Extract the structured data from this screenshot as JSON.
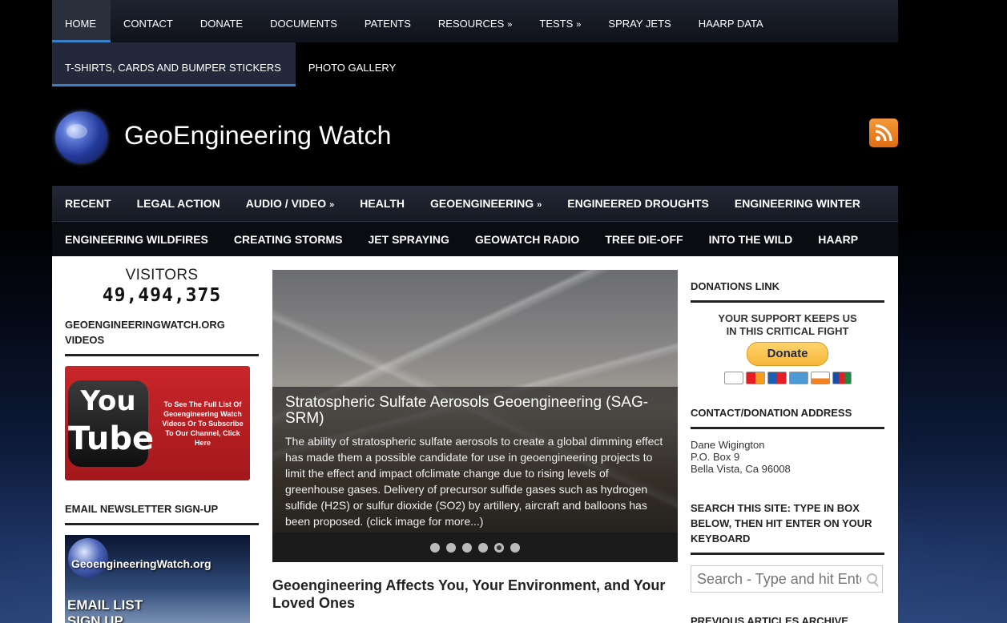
{
  "top_nav": {
    "row1": [
      {
        "label": "HOME",
        "active": true
      },
      {
        "label": "CONTACT"
      },
      {
        "label": "DONATE"
      },
      {
        "label": "DOCUMENTS"
      },
      {
        "label": "PATENTS"
      },
      {
        "label": "RESOURCES",
        "submenu": "»"
      },
      {
        "label": "TESTS",
        "submenu": "»"
      },
      {
        "label": "SPRAY JETS"
      },
      {
        "label": "HAARP DATA"
      }
    ],
    "row2": [
      {
        "label": "T-SHIRTS, CARDS AND BUMPER STICKERS"
      },
      {
        "label": "PHOTO GALLERY"
      }
    ]
  },
  "header": {
    "site_title": "GeoEngineering Watch",
    "logo_icon": "globe-icon",
    "rss_icon": "rss-icon"
  },
  "main_nav": {
    "row1": [
      {
        "label": "RECENT"
      },
      {
        "label": "LEGAL ACTION"
      },
      {
        "label": "AUDIO / VIDEO",
        "submenu": "»"
      },
      {
        "label": "HEALTH"
      },
      {
        "label": "GEOENGINEERING",
        "submenu": "»"
      },
      {
        "label": "ENGINEERED DROUGHTS"
      },
      {
        "label": "ENGINEERING WINTER"
      }
    ],
    "row2": [
      {
        "label": "ENGINEERING WILDFIRES"
      },
      {
        "label": "CREATING STORMS"
      },
      {
        "label": "JET SPRAYING"
      },
      {
        "label": "GEOWATCH RADIO"
      },
      {
        "label": "TREE DIE-OFF"
      },
      {
        "label": "INTO THE WILD"
      },
      {
        "label": "HAARP"
      }
    ]
  },
  "left_sidebar": {
    "visitors_label": "VISITORS",
    "visitors_count": "49,494,375",
    "videos_title": "GEOENGINEERINGWATCH.ORG VIDEOS",
    "youtube": {
      "you": "You",
      "tube": "Tube",
      "text": "To See The Full List Of Geoengineering Watch Videos Or To Subscribe To Our Channel, Click Here"
    },
    "newsletter_title": "EMAIL NEWSLETTER SIGN-UP",
    "newsletter_image": {
      "site": "GeoengineeringWatch.org",
      "line1": "EMAIL LIST",
      "line2": "SIGN UP"
    }
  },
  "slider": {
    "title": "Stratospheric Sulfate Aerosols Geoengineering (SAG-SRM)",
    "text": "The ability of stratospheric sulfate aerosols to create a global dimming effect has made them a possible candidate for use in geoengineering projects to limit the effect and impact ofclimate change due to rising levels of greenhouse gases. Delivery of precursor sulfide gases such as hydrogen sulfide (H2S) or sulfur dioxide (SO2) by artillery, aircraft and balloons has been proposed. (click image for more...)",
    "dot_count": 6,
    "active_dot": 5
  },
  "post_title": "Geoengineering Affects You, Your Environment, and Your Loved Ones",
  "right_sidebar": {
    "donations_title": "DONATIONS LINK",
    "support_line1": "YOUR SUPPORT KEEPS US",
    "support_line2": "IN THIS CRITICAL FIGHT",
    "donate_label": "Donate",
    "card_icons": [
      "visa-icon",
      "mastercard-icon",
      "maestro-icon",
      "amex-icon",
      "discover-icon",
      "jcb-icon"
    ],
    "address_title": "CONTACT/DONATION ADDRESS",
    "address_lines": [
      "Dane Wigington",
      "P.O. Box 9",
      "Bella Vista, Ca 96008"
    ],
    "search_title": "SEARCH THIS SITE: TYPE IN BOX BELOW, THEN HIT ENTER ON YOUR KEYBOARD",
    "search_placeholder": "Search - Type and hit Enter",
    "archive_title": "PREVIOUS ARTICLES ARCHIVE"
  },
  "colors": {
    "accent": "#3b7fc9",
    "youtube_red": "#c8262a",
    "donate_yellow": "#f6b73c",
    "rss_orange": "#e06c10"
  }
}
